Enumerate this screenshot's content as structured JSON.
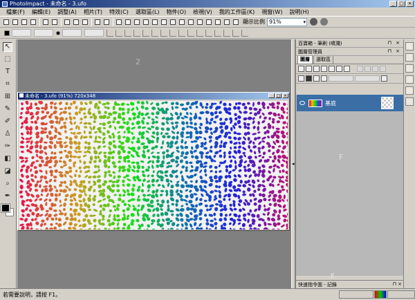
{
  "window": {
    "title": "PhotoImpact - 未命名 - 3.ufo",
    "min": "_",
    "max": "□",
    "close": "×"
  },
  "menu": [
    {
      "label": "檔案(F)"
    },
    {
      "label": "編輯(E)"
    },
    {
      "label": "調整(A)"
    },
    {
      "label": "相片(T)"
    },
    {
      "label": "特效(C)"
    },
    {
      "label": "選取區(L)"
    },
    {
      "label": "物件(O)"
    },
    {
      "label": "檢視(V)"
    },
    {
      "label": "我的工作區(K)"
    },
    {
      "label": "視窗(W)"
    },
    {
      "label": "說明(H)"
    }
  ],
  "toolbar": {
    "zoom_label": "顯示比例",
    "zoom_value": "91%"
  },
  "workspace": {
    "label": "2"
  },
  "document": {
    "title": "未命名 - 3.ufo (91%) 720x348"
  },
  "right_panel": {
    "top_bar": "百寶箱 - 筆刷 (噴濺)",
    "layer_manager": "圖層管理員",
    "tabs": [
      {
        "label": "圖層"
      },
      {
        "label": "選取區"
      }
    ],
    "layer": {
      "name": "基底"
    },
    "area_label": "F",
    "area_label2": "E",
    "quick_bar": "快速指令面 - 記錄"
  },
  "statusbar": {
    "text": "若需要說明，請按 F1。"
  },
  "colors": {
    "title_start": "#0a246a",
    "title_end": "#a6caf0",
    "selected_layer": "#3a6ea5",
    "workspace": "#808080"
  }
}
